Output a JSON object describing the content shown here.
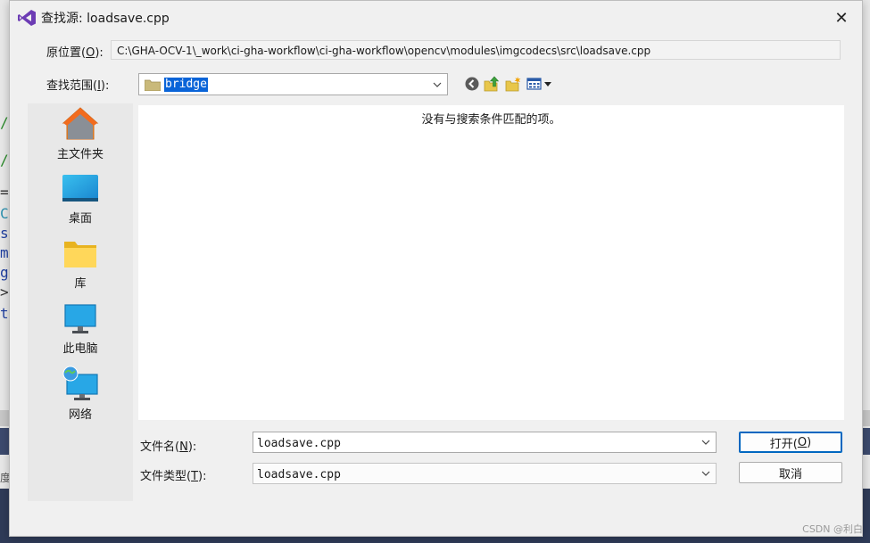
{
  "window": {
    "title": "查找源: loadsave.cpp",
    "close_glyph": "✕"
  },
  "background": {
    "code_chars": [
      "/",
      "/",
      "=",
      "C",
      "s",
      "m",
      "g",
      ">",
      "t"
    ],
    "side_text": "度"
  },
  "original_location": {
    "label_text": "原位置(",
    "label_key": "O",
    "label_suffix": "):",
    "path": "C:\\GHA-OCV-1\\_work\\ci-gha-workflow\\ci-gha-workflow\\opencv\\modules\\imgcodecs\\src\\loadsave.cpp"
  },
  "look_in": {
    "label_text": "查找范围(",
    "label_key": "I",
    "label_suffix": "):",
    "value": "bridge"
  },
  "toolbar": {
    "icons": [
      "back-icon",
      "up-folder-icon",
      "new-folder-icon",
      "view-menu-icon"
    ]
  },
  "places": [
    {
      "label": "主文件夹",
      "icon": "home-icon"
    },
    {
      "label": "桌面",
      "icon": "desktop-icon"
    },
    {
      "label": "库",
      "icon": "library-folder-icon"
    },
    {
      "label": "此电脑",
      "icon": "computer-icon"
    },
    {
      "label": "网络",
      "icon": "network-icon"
    }
  ],
  "file_list": {
    "empty_message": "没有与搜索条件匹配的项。"
  },
  "file_name": {
    "label_text": "文件名(",
    "label_key": "N",
    "label_suffix": "):",
    "value": "loadsave.cpp"
  },
  "file_type": {
    "label_text": "文件类型(",
    "label_key": "T",
    "label_suffix": "):",
    "value": "loadsave.cpp"
  },
  "buttons": {
    "open_text": "打开(",
    "open_key": "O",
    "open_suffix": ")",
    "cancel": "取消"
  },
  "watermark": "CSDN @利白",
  "colors": {
    "accent": "#0067c0",
    "selection": "#0a64d8",
    "vs_purple": "#6c3cb4"
  }
}
